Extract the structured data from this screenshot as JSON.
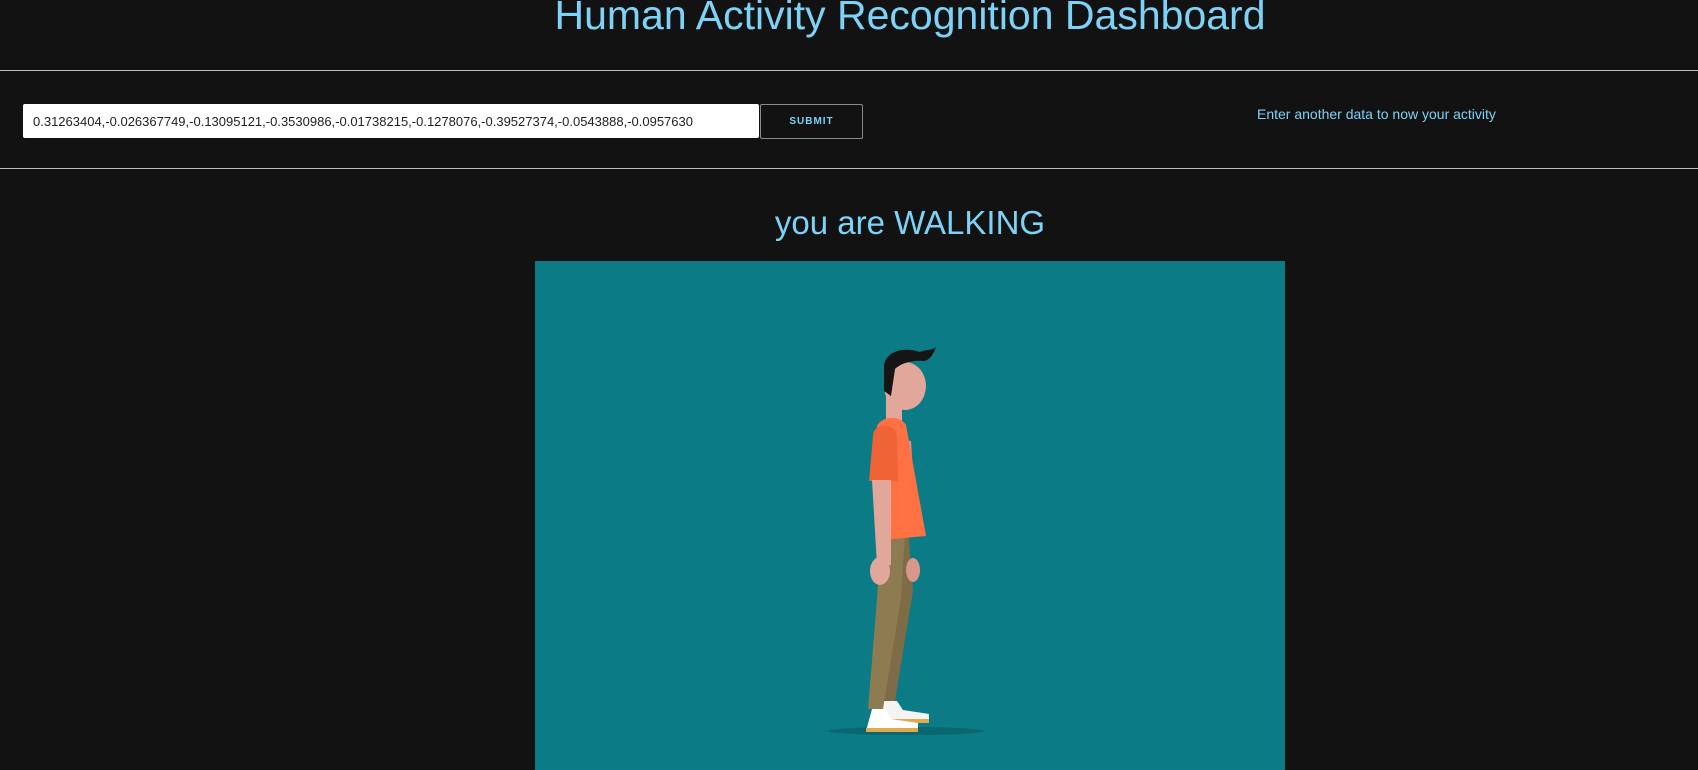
{
  "header": {
    "title": "Human Activity Recognition Dashboard"
  },
  "form": {
    "input_value": "0.31263404,-0.026367749,-0.13095121,-0.3530986,-0.01738215,-0.1278076,-0.39527374,-0.0543888,-0.0957630",
    "submit_label": "SUBMIT",
    "hint": "Enter another data to now your activity"
  },
  "result": {
    "text": "you are WALKING",
    "illustration": "walking-person-illustration"
  },
  "colors": {
    "background": "#121212",
    "accent": "#7cd3f7",
    "stage": "#0b7b86",
    "shirt": "#ff7043",
    "pants": "#8d7b52",
    "skin": "#e2a79b",
    "hair": "#151515"
  }
}
